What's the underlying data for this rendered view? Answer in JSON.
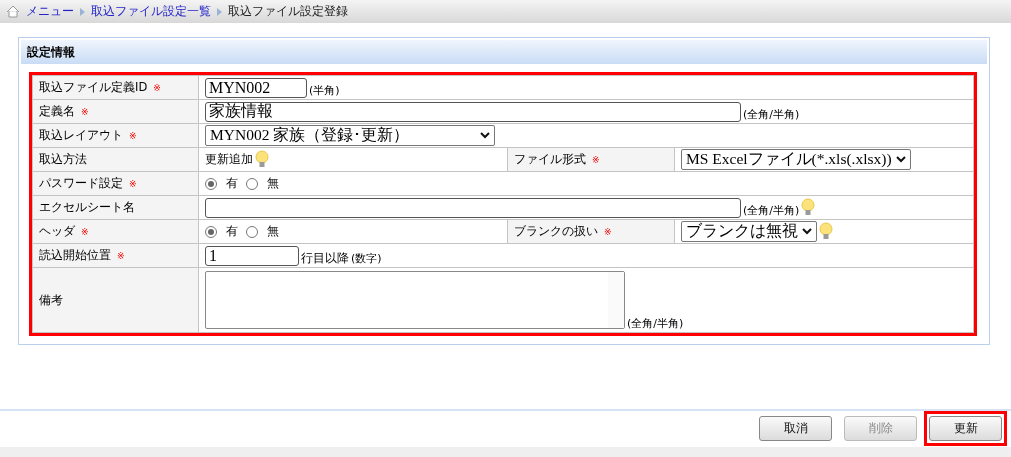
{
  "breadcrumb": [
    {
      "label": "メニュー",
      "link": true
    },
    {
      "label": "取込ファイル設定一覧",
      "link": true
    },
    {
      "label": "取込ファイル設定登録",
      "link": false
    }
  ],
  "panel": {
    "title": "設定情報",
    "highlighted": true,
    "rows": [
      {
        "label": "取込ファイル定義ID",
        "required": true,
        "field": {
          "kind": "input",
          "value": "MYN002",
          "note": "(半角)"
        }
      },
      {
        "label": "定義名",
        "required": true,
        "field": {
          "kind": "input",
          "value": "家族情報",
          "note": "(全角/半角)"
        }
      },
      {
        "label": "取込レイアウト",
        "required": true,
        "field": {
          "kind": "select",
          "value": "MYN002 家族（登録･更新）"
        }
      },
      {
        "label": "取込方法",
        "required": false,
        "field": {
          "kind": "text",
          "value": "更新追加",
          "hint": true
        },
        "side": {
          "label": "ファイル形式",
          "required": true,
          "field": {
            "kind": "select",
            "value": "MS Excelファイル(*.xls(.xlsx))"
          }
        }
      },
      {
        "label": "パスワード設定",
        "required": true,
        "field": {
          "kind": "radio",
          "options": [
            {
              "label": "有",
              "selected": true
            },
            {
              "label": "無",
              "selected": false
            }
          ]
        }
      },
      {
        "label": "エクセルシート名",
        "required": false,
        "field": {
          "kind": "input",
          "note": "(全角/半角)",
          "hint": true
        }
      },
      {
        "label": "ヘッダ",
        "required": true,
        "field": {
          "kind": "radio",
          "options": [
            {
              "label": "有",
              "selected": true
            },
            {
              "label": "無",
              "selected": false
            }
          ]
        },
        "side": {
          "label": "ブランクの扱い",
          "required": true,
          "field": {
            "kind": "select",
            "value": "ブランクは無視",
            "hint": true
          }
        }
      },
      {
        "label": "読込開始位置",
        "required": true,
        "field": {
          "kind": "input",
          "value": "1",
          "suffix": "行目以降",
          "note": "(数字)"
        }
      },
      {
        "label": "備考",
        "required": false,
        "field": {
          "kind": "textarea",
          "note": "(全角/半角)"
        }
      }
    ]
  },
  "required_mark": "※",
  "buttons": [
    {
      "label": "取消",
      "disabled": false,
      "highlighted": false
    },
    {
      "label": "削除",
      "disabled": true,
      "highlighted": false
    },
    {
      "label": "更新",
      "disabled": false,
      "highlighted": true
    }
  ]
}
